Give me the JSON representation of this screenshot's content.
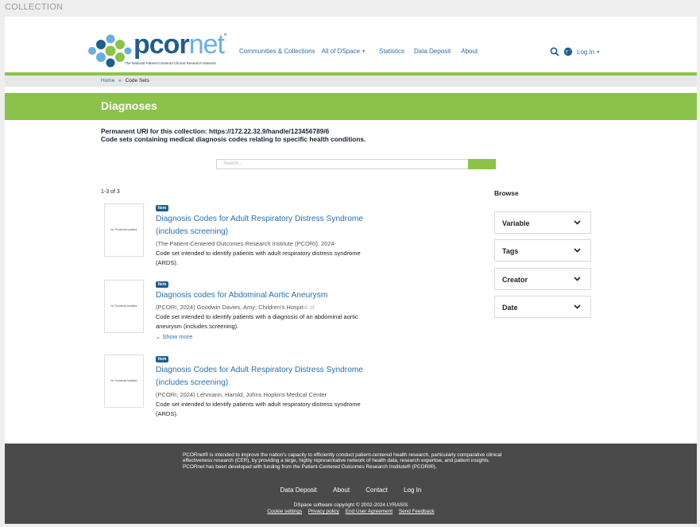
{
  "window": {
    "label": "COLLECTION"
  },
  "brand": {
    "word_pcor": "pcor",
    "word_net": "net",
    "tm": "°",
    "tagline": "The National Patient-Centered Clinical Research Network",
    "colors": {
      "dark_blue": "#1f5d8c",
      "light_blue": "#6aaee0",
      "green": "#8bc34a"
    }
  },
  "nav": {
    "communities": "Communities & Collections",
    "all_of_dspace": "All of DSpace",
    "statistics": "Statistics",
    "data_deposit": "Data Deposit",
    "about": "About",
    "login": "Log In"
  },
  "breadcrumb": {
    "home": "Home",
    "separator": "»",
    "current": "Code Sets"
  },
  "page": {
    "title": "Diagnoses",
    "uri_label": "Permanent URI for this collection:",
    "uri_value": "https://172.22.32.9/handle/123456789/6",
    "description": "Code sets containing medical diagnosis codes relating to specific health conditions."
  },
  "search": {
    "placeholder": "Search..."
  },
  "results": {
    "count": "1-3 of 3",
    "thumb_text": "No Thumbnail Available",
    "badge": "Item",
    "show_more": "Show more",
    "items": [
      {
        "title": "Diagnosis Codes for Adult Respiratory Distress Syndrome (includes screening)",
        "meta": "(The Patient-Centered Outcomes Research Institute (PCORI), 2024-",
        "abstract": "Code set intended to identify patients with adult respiratory distress syndrome (ARDS)."
      },
      {
        "title": "Diagnosis codes for Abdominal Aortic Aneurysm",
        "meta": "(PCORI, 2024) Goodwin Davies, Amy; Children's Hospit",
        "meta_fade": "al of",
        "abstract": "Code set intended to identify patients with a diagnosis of an abdominal aortic aneurysm (includes screening)."
      },
      {
        "title": "Diagnosis Codes for Adult Respiratory Distress Syndrome (includes screening)",
        "meta": "(PCORI, 2024) Lehmann, Harold; Johns Hopkins Medical Center",
        "abstract": "Code set intended to identify patients with adult respiratory distress syndrome (ARDS)."
      }
    ]
  },
  "sidebar": {
    "heading": "Browse",
    "facets": [
      "Variable",
      "Tags",
      "Creator",
      "Date"
    ]
  },
  "footer": {
    "blurb": "PCORnet® is intended to improve the nation's capacity to efficiently conduct patient-centered health research, particularly comparative clinical effectiveness research (CER), by providing a large, highly representative network of health data, research expertise, and patient insights. PCORnet has been developed with funding from the Patient-Centered Outcomes Research Institute® (PCORI®).",
    "links": [
      "Data Deposit",
      "About",
      "Contact",
      "Log In"
    ],
    "copyright": "DSpace software copyright © 2002-2024 LYRASIS",
    "policies": [
      "Cookie settings",
      "Privacy policy",
      "End User Agreement",
      "Send Feedback"
    ]
  }
}
